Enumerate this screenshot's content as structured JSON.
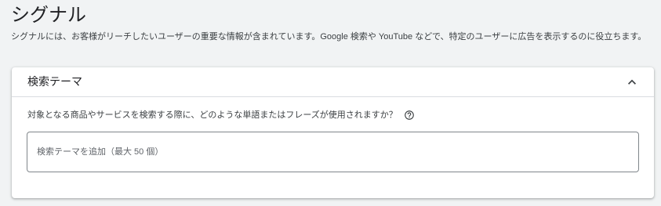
{
  "section": {
    "title": "シグナル",
    "description": "シグナルには、お客様がリーチしたいユーザーの重要な情報が含まれています。Google 検索や YouTube などで、特定のユーザーに広告を表示するのに役立ちます。"
  },
  "card": {
    "title": "検索テーマ",
    "collapse_icon": "chevron-up-icon",
    "question": "対象となる商品やサービスを検索する際に、どのような単語またはフレーズが使用されますか？",
    "help_icon": "help-circle-icon",
    "input": {
      "value": "",
      "placeholder": "検索テーマを追加（最大 50 個）"
    }
  },
  "colors": {
    "background": "#f1f3f4",
    "card": "#ffffff",
    "border": "#80868b",
    "divider": "#dadce0",
    "text_primary": "#202124",
    "text_secondary": "#3c4043"
  }
}
